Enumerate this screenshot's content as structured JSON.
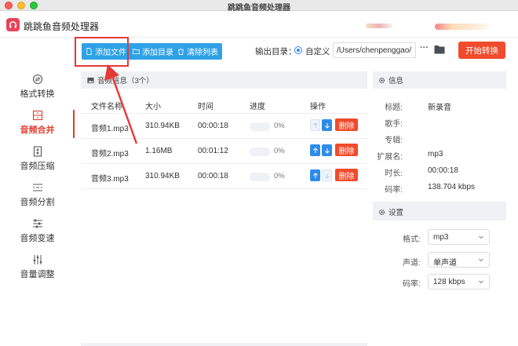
{
  "window": {
    "title": "跳跳鱼音频处理器"
  },
  "app": {
    "name": "跳跳鱼音频处理器"
  },
  "sidebar": {
    "items": [
      {
        "label": "格式转换",
        "icon": "format-convert-icon",
        "active": false
      },
      {
        "label": "音频合并",
        "icon": "audio-merge-icon",
        "active": true
      },
      {
        "label": "音频压缩",
        "icon": "audio-compress-icon",
        "active": false
      },
      {
        "label": "音频分割",
        "icon": "audio-split-icon",
        "active": false
      },
      {
        "label": "音频变速",
        "icon": "audio-speed-icon",
        "active": false
      },
      {
        "label": "音量调整",
        "icon": "volume-adjust-icon",
        "active": false
      }
    ]
  },
  "toolbar": {
    "add_file": "添加文件",
    "add_folder": "添加目录",
    "clear_list": "清除列表",
    "output_label": "输出目录：",
    "custom_label": "自定义",
    "output_path": "/Users/chenpenggao/D",
    "more": "···",
    "start": "开始转换"
  },
  "file_list": {
    "title": "音频信息（3个）",
    "columns": {
      "name": "文件名称",
      "size": "大小",
      "time": "时间",
      "progress": "进度",
      "action": "操作"
    },
    "rows": [
      {
        "name": "音频1.mp3",
        "size": "310.94KB",
        "time": "00:00:18",
        "progress": "0%",
        "delete": "删除"
      },
      {
        "name": "音频2.mp3",
        "size": "1.16MB",
        "time": "00:01:12",
        "progress": "0%",
        "delete": "删除"
      },
      {
        "name": "音频3.mp3",
        "size": "310.94KB",
        "time": "00:00:18",
        "progress": "0%",
        "delete": "删除"
      }
    ]
  },
  "info": {
    "title": "信息",
    "fields": [
      {
        "key": "标题:",
        "value": "新录音"
      },
      {
        "key": "歌手:",
        "value": ""
      },
      {
        "key": "专辑:",
        "value": ""
      },
      {
        "key": "扩展名:",
        "value": "mp3"
      },
      {
        "key": "时长:",
        "value": "00:00:18"
      },
      {
        "key": "码率:",
        "value": "138.704 kbps"
      }
    ]
  },
  "settings": {
    "title": "设置",
    "format_label": "格式:",
    "format_value": "mp3",
    "channel_label": "声道:",
    "channel_value": "单声道",
    "bitrate_label": "码率:",
    "bitrate_value": "128 kbps"
  },
  "colors": {
    "accent_red": "#f04b2c",
    "accent_blue": "#2fa1e6",
    "highlight_box": "#e53935"
  }
}
